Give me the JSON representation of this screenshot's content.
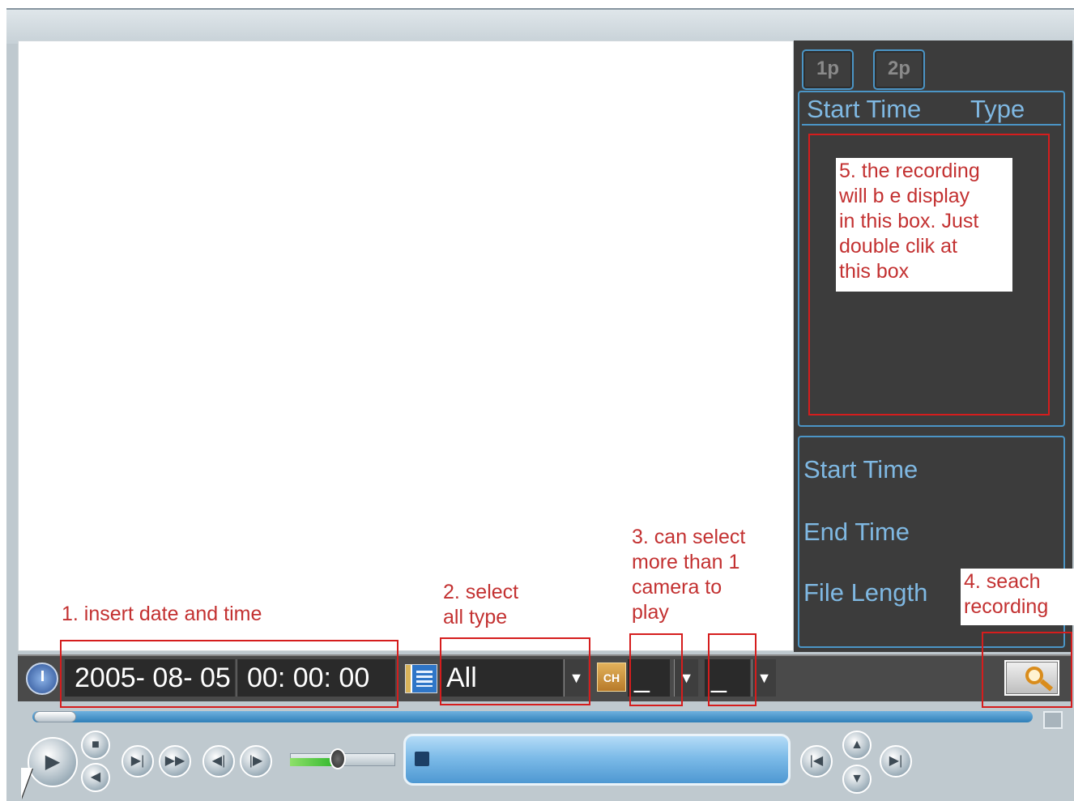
{
  "page_buttons": [
    "1p",
    "2p"
  ],
  "list_header": {
    "start_time": "Start Time",
    "type": "Type"
  },
  "annotations": {
    "step1": "1. insert date and time",
    "step2": "2. select\nall type",
    "step3": "3. can select\nmore than 1\ncamera to\nplay",
    "step4": "4. seach\nrecording",
    "step5": "5. the recording\nwill b e display\nin this box. Just\ndouble clik at\nthis box"
  },
  "info": {
    "start_time": "Start Time",
    "end_time": "End Time",
    "file_length": "File Length"
  },
  "toolbar": {
    "date": "2005- 08- 05",
    "time": "00: 00: 00",
    "type_value": "All",
    "channel_icon": "CH",
    "channel1_value": "_",
    "channel2_value": "_"
  },
  "playback": {
    "volume_level": 0.45
  },
  "icons": {
    "clock": "clock-icon",
    "type": "list-icon",
    "channel": "channel-icon",
    "search": "magnifier-icon",
    "fullscreen": "fullscreen-icon"
  },
  "colors": {
    "accent_blue": "#4b95c6",
    "annotation_red": "#d51d1d",
    "panel_dark": "#3c3c3c"
  }
}
